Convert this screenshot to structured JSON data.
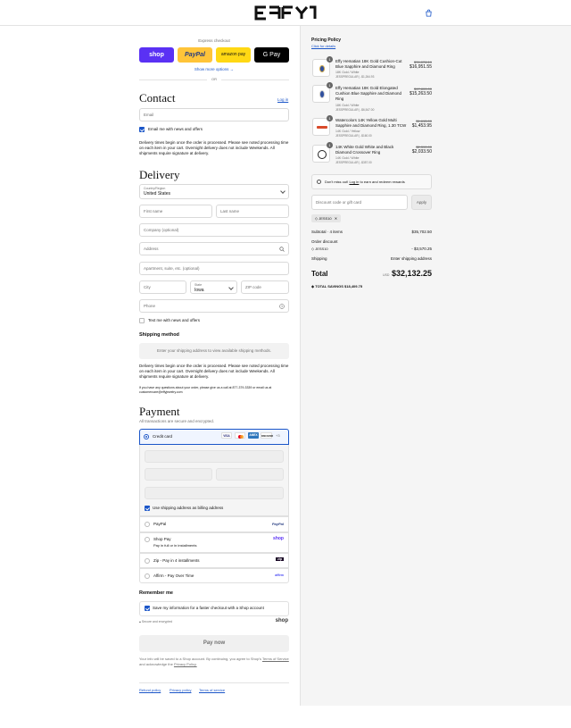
{
  "header": {
    "brand": "EFFY"
  },
  "express": {
    "title": "Express checkout",
    "shop": "shop",
    "paypal": "PayPal",
    "amazon": "amazon pay",
    "gpay": "G Pay",
    "more": "Show more options →",
    "or": "OR"
  },
  "contact": {
    "title": "Contact",
    "login": "Log in",
    "email_placeholder": "Email",
    "news_label": "Email me with news and offers",
    "delivery_note": "Delivery times begin once the order is processed. Please see noted processing time on each item in your cart. Overnight delivery does not include Weekends. All shipments require signature at delivery."
  },
  "delivery": {
    "title": "Delivery",
    "country_label": "Country/Region",
    "country_value": "United States",
    "first_name": "First name",
    "last_name": "Last name",
    "company": "Company (optional)",
    "address": "Address",
    "apartment": "Apartment, suite, etc. (optional)",
    "city": "City",
    "state_label": "State",
    "state_value": "Iowa",
    "zip": "ZIP code",
    "phone": "Phone",
    "text_label": "Text me with news and offers"
  },
  "shipping": {
    "title": "Shipping method",
    "placeholder": "Enter your shipping address to view available shipping methods.",
    "note": "Delivery times begin once the order is processed. Please see noted processing time on each item in your cart. Overnight delivery does not include Weekends. All shipments require signature at delivery.",
    "contact_note": "If you have any questions about your order, please give us a call at 877-379-3339 or email us at customercare@effyjewelry.com"
  },
  "payment": {
    "title": "Payment",
    "subtitle": "All transactions are secure and encrypted.",
    "credit_card": "Credit card",
    "cards": [
      "VISA",
      "MC",
      "AMEX",
      "DISCOVER",
      "+3"
    ],
    "billing_label": "Use shipping address as billing address",
    "options": [
      {
        "name": "PayPal",
        "sub": "",
        "logo": "PayPal"
      },
      {
        "name": "Shop Pay",
        "sub": "Pay in full or in installments",
        "logo": "shop"
      },
      {
        "name": "Zip - Pay in 4 installments",
        "sub": "",
        "logo": "zip"
      },
      {
        "name": "Affirm - Pay Over Time",
        "sub": "",
        "logo": "affirm"
      }
    ]
  },
  "remember": {
    "title": "Remember me",
    "save_label": "Save my information for a faster checkout with a Shop account",
    "secure": "Secure and encrypted",
    "shop": "shop"
  },
  "pay_button": "Pay now",
  "legal": {
    "text": "Your info will be saved to a Shop account. By continuing, you agree to Shop's",
    "tos": "Terms of Service",
    "and": "and acknowledge the",
    "privacy": "Privacy Policy."
  },
  "footer": {
    "links": [
      "Refund policy",
      "Privacy policy",
      "Terms of service"
    ]
  },
  "summary": {
    "pricing_title": "Pricing Policy",
    "pricing_link": "Click for details",
    "items": [
      {
        "qty": "1",
        "name": "Effy Hematian 18K Gold Cushion-Cut Blue Sapphire and Diamond Ring",
        "meta": "18K Gold / White",
        "code": "JESSPREGULAR | -$1,264.93",
        "strike": "$74,078.19",
        "price": "$16,951.55",
        "color": "#2f4f9e"
      },
      {
        "qty": "1",
        "name": "Effy Hematian 18K Gold Elongated Cushion Blue Sapphire and Diamond Ring",
        "meta": "18K Gold / White",
        "code": "JESSPREGULAR | -$6,547.00",
        "strike": "$17,800.00",
        "price": "$15,263.50",
        "color": "#2f4f9e"
      },
      {
        "qty": "1",
        "name": "Watercolors 14K Yellow Gold Multi Sapphire and Diamond Ring, 1.30 TCW",
        "meta": "14K Gold / Yellow",
        "code": "JESSPREGULAR | -$160.00",
        "strike": "$1,615.00",
        "price": "$1,453.95",
        "color": "#d94a2a"
      },
      {
        "qty": "1",
        "name": "14K White Gold White and Black Diamond Crossover Ring",
        "meta": "14K Gold / White",
        "code": "JESSPREGULAR | -$357.00",
        "strike": "$2,390.00",
        "price": "$2,033.50",
        "color": "#222"
      }
    ],
    "login_note": "Don't miss out!",
    "login_link": "Log in",
    "login_rest": "to earn and redeem rewards",
    "discount_placeholder": "Discount code or gift card",
    "apply": "Apply",
    "tag": "JESS10",
    "subtotal_label": "Subtotal · 4 items",
    "subtotal": "$35,702.50",
    "order_discount_label": "Order discount",
    "discount_code": "JESS10",
    "discount_value": "- $3,570.25",
    "shipping_label": "Shipping",
    "shipping_value": "Enter shipping address",
    "total_label": "Total",
    "currency": "USD",
    "total": "$32,132.25",
    "savings_label": "TOTAL SAVINGS",
    "savings": "$18,409.75"
  }
}
